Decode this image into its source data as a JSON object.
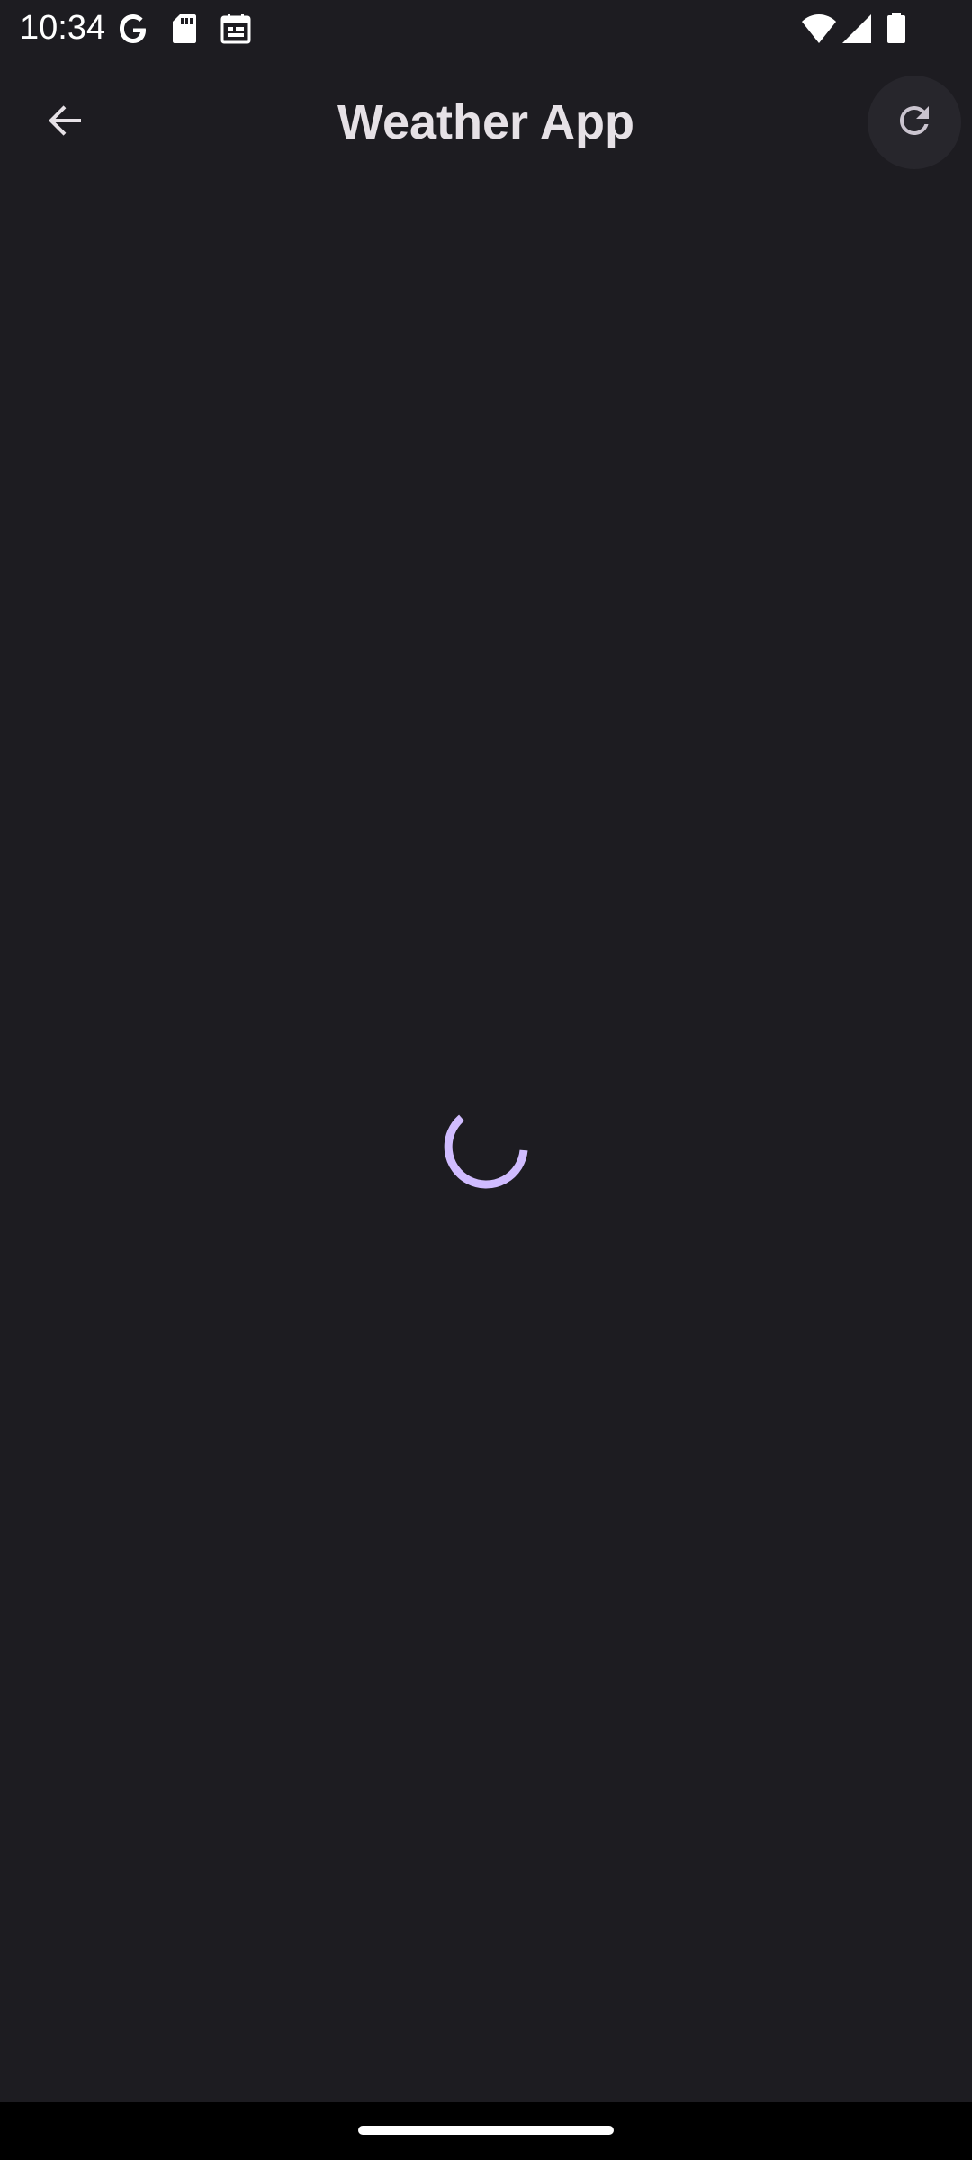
{
  "status_bar": {
    "time": "10:34",
    "left_icons": [
      "google-icon",
      "sd-card-icon",
      "calendar-icon"
    ],
    "right_icons": [
      "wifi-icon",
      "signal-icon",
      "battery-icon"
    ]
  },
  "app_bar": {
    "title": "Weather App",
    "back_icon": "arrow-back-icon",
    "refresh_icon": "refresh-icon"
  },
  "content": {
    "state": "loading",
    "spinner_color": "#d0bcff"
  },
  "colors": {
    "background": "#1d1c21",
    "title_text": "#e6e1e6",
    "refresh_button_bg": "#27262c",
    "accent": "#d0bcff"
  }
}
